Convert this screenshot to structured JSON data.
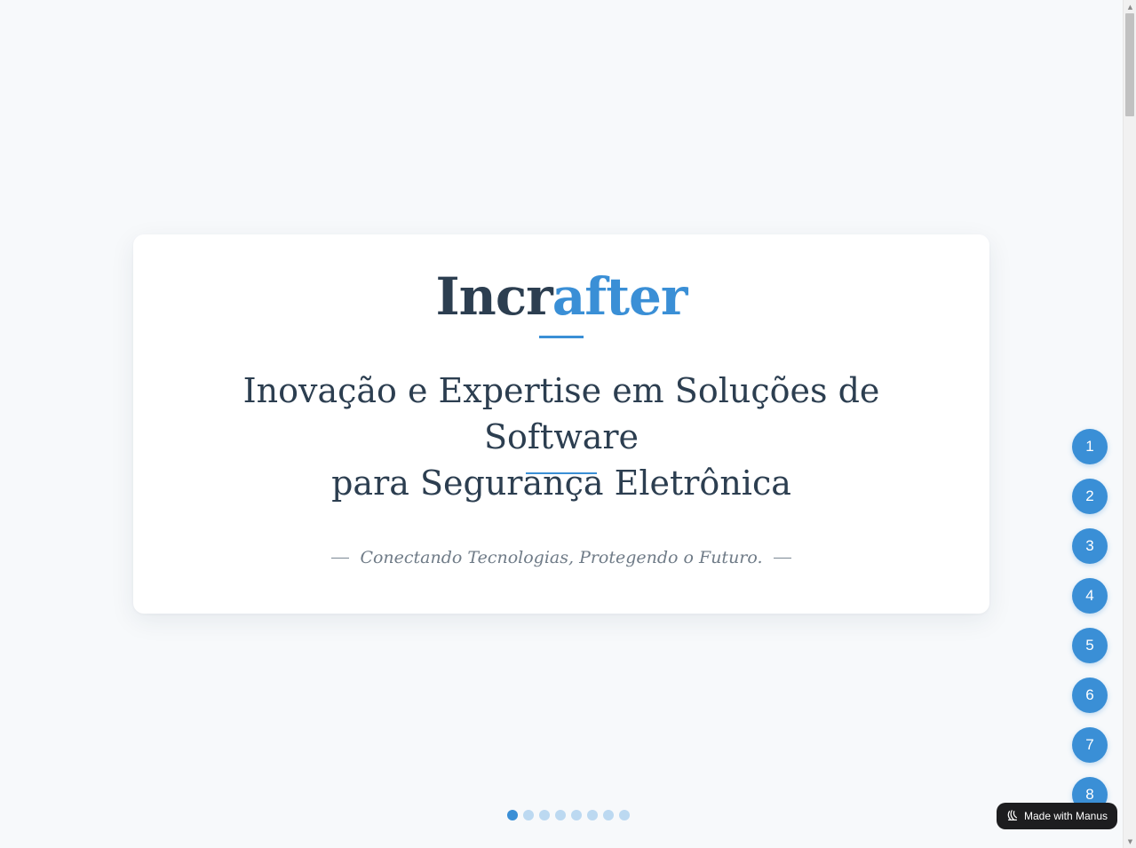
{
  "brand": {
    "part1": "Incr",
    "part2": "after"
  },
  "headline": {
    "line1": "Inovação e Expertise em Soluções de Software",
    "line2": "para Segurança Eletrônica"
  },
  "tagline": "Conectando Tecnologias, Protegendo o Futuro.",
  "slide_nav": [
    "1",
    "2",
    "3",
    "4",
    "5",
    "6",
    "7",
    "8"
  ],
  "dots": {
    "count": 8,
    "active_index": 0
  },
  "badge": {
    "label": "Made with Manus",
    "icon": "manus-logo-icon"
  },
  "colors": {
    "accent": "#3a8fd6",
    "text": "#2c3e50",
    "background": "#f7f9fb"
  }
}
